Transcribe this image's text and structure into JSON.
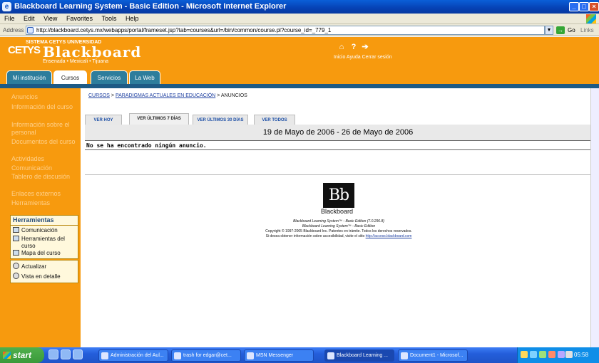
{
  "window": {
    "title": "Blackboard Learning System - Basic Edition - Microsoft Internet Explorer",
    "menu": [
      "File",
      "Edit",
      "View",
      "Favorites",
      "Tools",
      "Help"
    ],
    "address_label": "Address",
    "url": "http://blackboard.cetys.mx/webapps/portal/frameset.jsp?tab=courses&url=/bin/common/course.pl?course_id=_779_1",
    "go_label": "Go",
    "links_label": "Links"
  },
  "header": {
    "logo_cetys": "CETYS",
    "logo_sistema": "SISTEMA CETYS UNIVERSIDAD",
    "logo_blackboard": "Blackboard",
    "logo_sub": "Ensenada • Mexicali • Tijuana",
    "top_links": "Inicio  Ayuda  Cerrar sesión",
    "tabs": [
      "Mi institución",
      "Cursos",
      "Servicios",
      "La Web"
    ],
    "active_tab": "Cursos"
  },
  "sidebar": {
    "nav": [
      "Anuncios",
      "Información del curso",
      "Información sobre el personal",
      "Documentos del curso",
      "Actividades",
      "Comunicación",
      "Tablero de discusión",
      "Enlaces externos",
      "Herramientas"
    ],
    "tools_title": "Herramientas",
    "tools": [
      "Comunicación",
      "Herramientas del curso",
      "Mapa del curso"
    ],
    "actions": [
      "Actualizar",
      "Vista en detalle"
    ]
  },
  "content": {
    "breadcrumb": {
      "cursos": "CURSOS",
      "sep": ">",
      "course": "PARADIGMAS ACTUALES EN EDUCACIÓN",
      "current": "ANUNCIOS"
    },
    "view_tabs": [
      "VER HOY",
      "VER ÚLTIMOS 7 DÍAS",
      "VER ÚLTIMOS 30 DÍAS",
      "VER TODOS"
    ],
    "active_view": "VER ÚLTIMOS 7 DÍAS",
    "date_range": "19 de Mayo de 2006 - 26 de Mayo de 2006",
    "no_announcements": "No se ha encontrado ningún anuncio.",
    "bb_logo": "Bb",
    "bb_word": "Blackboard",
    "footer": {
      "line1": "Blackboard Learning System™ - Basic Edition (7.0.296.8)",
      "line2": "Blackboard Learning System™ - Basic Edition",
      "line3": "Copyright © 1997-2005 Blackboard Inc. Patentes en trámite. Todos los derechos reservados.",
      "line4_prefix": "Si desea obtener información sobre accesibilidad, visite el sitio",
      "line4_link": "http://access.blackboard.com"
    }
  },
  "taskbar": {
    "start": "start",
    "tasks": [
      "Administración del Aul...",
      "trash for edgar@cet...",
      "MSN Messenger",
      "Blackboard Learning ...",
      "Document1 - Microsof..."
    ],
    "active_task": "Blackboard Learning ...",
    "clock": "05:58 p.m."
  }
}
